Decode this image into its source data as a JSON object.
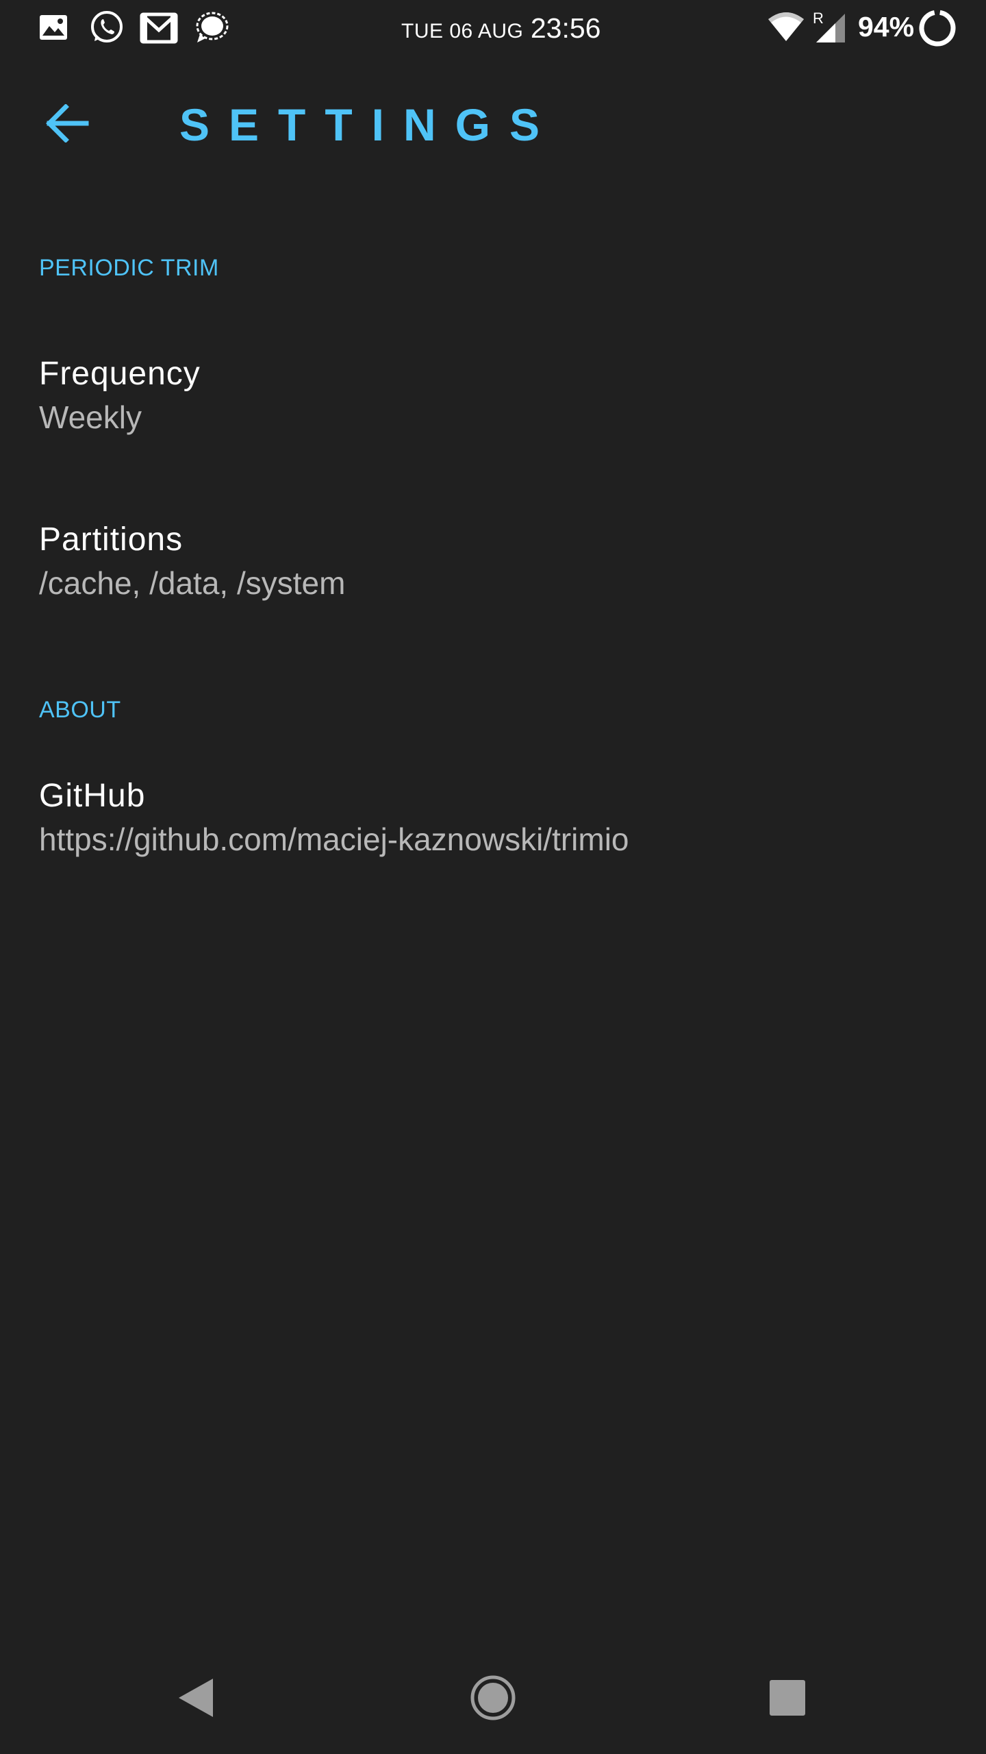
{
  "status_bar": {
    "date": "TUE 06 AUG",
    "time": "23:56",
    "battery_percent": "94%",
    "roaming_indicator": "R",
    "notification_icons": [
      "image-icon",
      "whatsapp-icon",
      "gmail-icon",
      "signal-icon"
    ],
    "system_icons": [
      "wifi-icon",
      "cell-signal-icon",
      "battery-ring-icon"
    ]
  },
  "app_bar": {
    "back_icon": "back-arrow-icon",
    "title": "SETTINGS"
  },
  "sections": [
    {
      "header": "PERIODIC TRIM",
      "items": [
        {
          "title": "Frequency",
          "summary": "Weekly"
        },
        {
          "title": "Partitions",
          "summary": "/cache, /data, /system"
        }
      ]
    },
    {
      "header": "ABOUT",
      "items": [
        {
          "title": "GitHub",
          "summary": "https://github.com/maciej-kaznowski/trimio"
        }
      ]
    }
  ],
  "nav_bar": {
    "buttons": [
      "back-triangle-icon",
      "home-circle-icon",
      "recents-square-icon"
    ]
  },
  "colors": {
    "background": "#202020",
    "accent": "#4fc3f7",
    "primary_text": "#ffffff",
    "secondary_text": "#b8b8b8",
    "nav_icon": "#9e9e9e"
  }
}
